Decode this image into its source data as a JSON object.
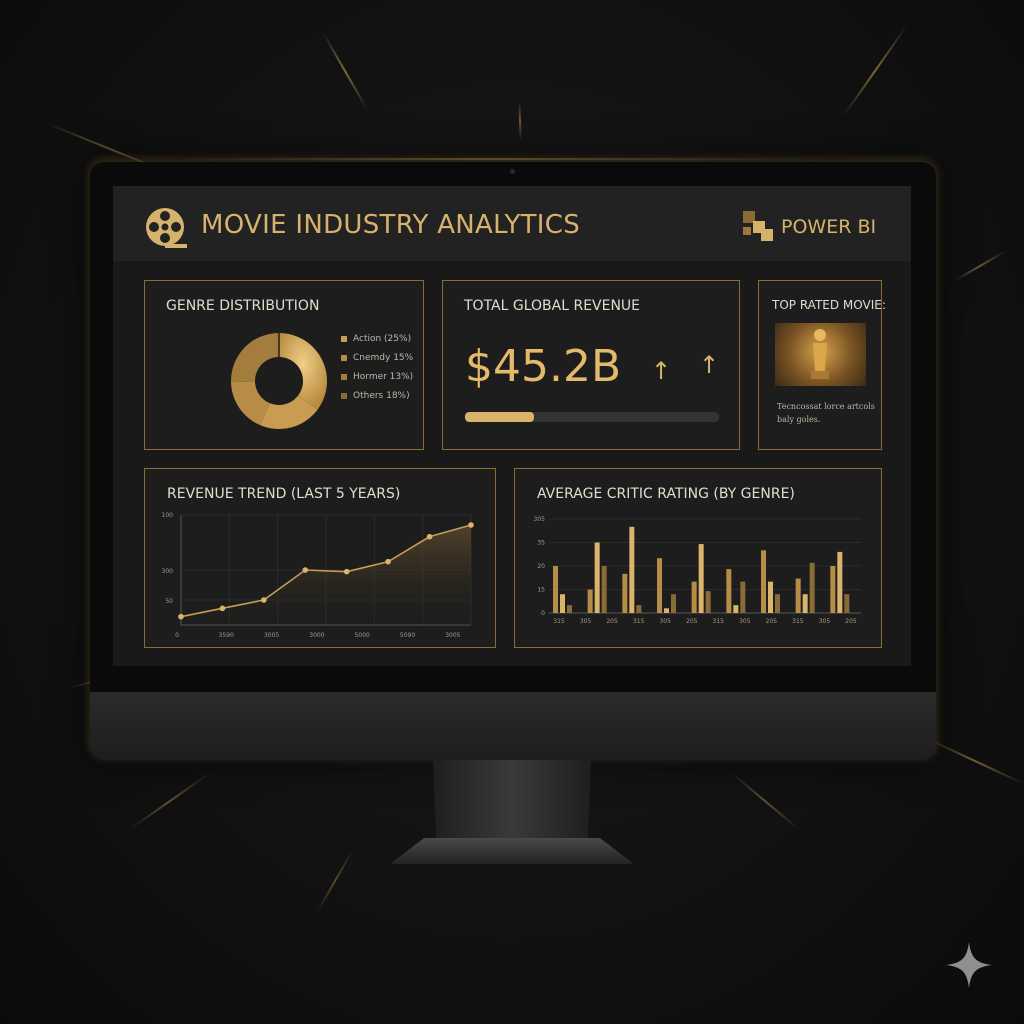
{
  "header": {
    "app_title": "MOVIE INDUSTRY ANALYTICS",
    "brand_label": "POWER BI"
  },
  "genre_card": {
    "title": "GENRE DISTRIBUTION",
    "legend": [
      "Action (25%)",
      "Cnemdy 15%",
      "Hormer 13%)",
      "Others 18%)"
    ]
  },
  "revenue_card": {
    "title": "TOTAL GLOBAL REVENUE",
    "value": "$45.2B",
    "arrow_1": "↑",
    "arrow_2": "↑",
    "progress": 0.27
  },
  "top_movie_card": {
    "title": "TOP RATED MOVIE:",
    "description": "Tecncossat lorce artcols baly goles."
  },
  "trend_card": {
    "title": "REVENUE TREND (LAST 5 YEARS)"
  },
  "rating_card": {
    "title": "AVERAGE CRITIC RATING (BY GENRE)"
  },
  "colors": {
    "gold": "#d6b36c",
    "gold_dark": "#8a6a35",
    "panel": "#1d1d1d",
    "background": "#121212"
  },
  "chart_data": [
    {
      "type": "pie",
      "title": "GENRE DISTRIBUTION",
      "labels": [
        "Action (25%)",
        "Cnemdy 15%",
        "Hormer 13%)",
        "Others 18%)"
      ],
      "values": [
        25,
        15,
        13,
        18
      ]
    },
    {
      "type": "area",
      "title": "REVENUE TREND (LAST 5 YEARS)",
      "x_tick_labels": [
        "0",
        "3590",
        "3005",
        "3000",
        "5000",
        "5090",
        "3005"
      ],
      "y_tick_labels": [
        "100",
        "300",
        "50"
      ],
      "values": [
        5,
        10,
        15,
        33,
        32,
        38,
        53,
        60
      ],
      "ylim": [
        0,
        66
      ]
    },
    {
      "type": "bar",
      "title": "AVERAGE CRITIC RATING (BY GENRE)",
      "x_tick_labels": [
        "315",
        "305",
        "205",
        "315",
        "305",
        "205",
        "315",
        "305",
        "205",
        "315",
        "305",
        "205"
      ],
      "y_tick_labels": [
        "305",
        "35",
        "20",
        "15",
        "0"
      ],
      "series": [
        {
          "values": [
            30,
            15,
            25,
            35,
            20,
            28,
            40,
            22,
            30
          ]
        },
        {
          "values": [
            12,
            45,
            55,
            3,
            44,
            5,
            20,
            12,
            39
          ]
        },
        {
          "values": [
            5,
            30,
            5,
            12,
            14,
            20,
            12,
            32,
            12
          ]
        }
      ]
    }
  ]
}
